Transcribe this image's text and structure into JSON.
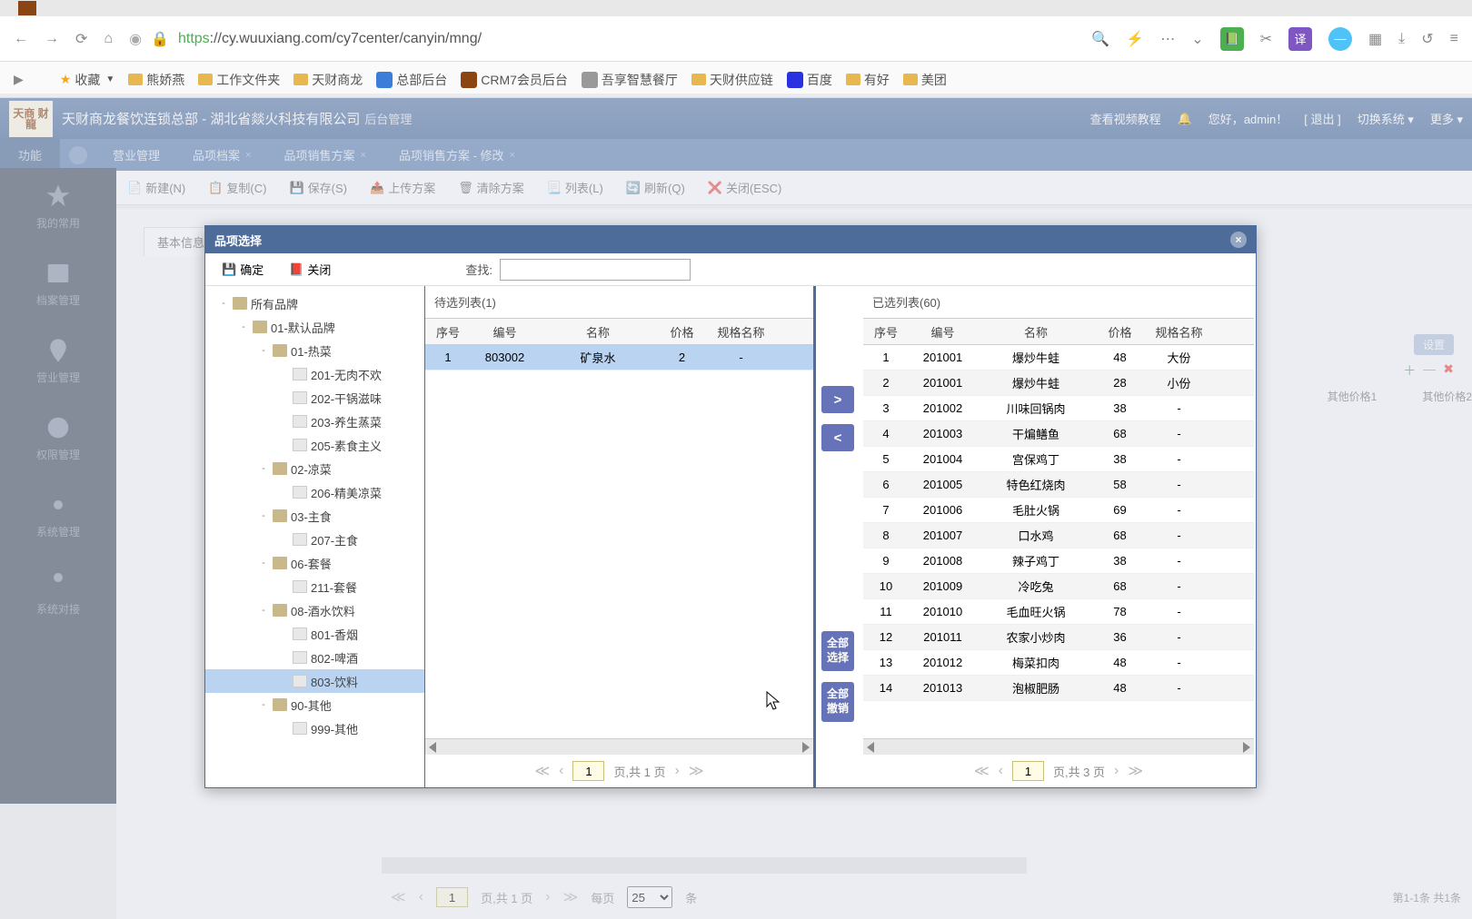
{
  "browser": {
    "url_prefix": "https",
    "url_rest": "://cy.wuuxiang.com/cy7center/canyin/mng/",
    "bookmarks": {
      "fav": "收藏",
      "items": [
        "熊娇燕",
        "工作文件夹",
        "天财商龙",
        "总部后台",
        "CRM7会员后台",
        "吾享智慧餐厅",
        "天财供应链",
        "百度",
        "有好",
        "美团"
      ]
    }
  },
  "app": {
    "logo_text": "天商\n财龍",
    "title": "天财商龙餐饮连锁总部 - 湖北省燚火科技有限公司",
    "subtitle": "后台管理",
    "header_right": {
      "video": "查看视频教程",
      "greet": "您好，",
      "user": "admin！",
      "logout": "[ 退出 ]",
      "switch": "切换系统",
      "more": "更多"
    },
    "func_label": "功能",
    "tabs": [
      "营业管理",
      "品项档案",
      "品项销售方案",
      "品项销售方案 - 修改"
    ],
    "toolbar": [
      "新建(N)",
      "复制(C)",
      "保存(S)",
      "上传方案",
      "清除方案",
      "列表(L)",
      "刷新(Q)",
      "关闭(ESC)"
    ],
    "sub_tab": "基本信息",
    "sidebar": [
      "我的常用",
      "档案管理",
      "营业管理",
      "权限管理",
      "系统管理",
      "系统对接"
    ]
  },
  "modal": {
    "title": "品项选择",
    "ok": "确定",
    "close_btn": "关闭",
    "search_label": "查找:",
    "tree": [
      {
        "lvl": 0,
        "type": "folder",
        "toggle": "-",
        "label": "所有品牌"
      },
      {
        "lvl": 1,
        "type": "folder",
        "toggle": "-",
        "label": "01-默认品牌"
      },
      {
        "lvl": 2,
        "type": "folder",
        "toggle": "-",
        "label": "01-热菜"
      },
      {
        "lvl": 3,
        "type": "leaf",
        "label": "201-无肉不欢"
      },
      {
        "lvl": 3,
        "type": "leaf",
        "label": "202-干锅滋味"
      },
      {
        "lvl": 3,
        "type": "leaf",
        "label": "203-养生蒸菜"
      },
      {
        "lvl": 3,
        "type": "leaf",
        "label": "205-素食主义"
      },
      {
        "lvl": 2,
        "type": "folder",
        "toggle": "-",
        "label": "02-凉菜"
      },
      {
        "lvl": 3,
        "type": "leaf",
        "label": "206-精美凉菜"
      },
      {
        "lvl": 2,
        "type": "folder",
        "toggle": "-",
        "label": "03-主食"
      },
      {
        "lvl": 3,
        "type": "leaf",
        "label": "207-主食"
      },
      {
        "lvl": 2,
        "type": "folder",
        "toggle": "-",
        "label": "06-套餐"
      },
      {
        "lvl": 3,
        "type": "leaf",
        "label": "211-套餐"
      },
      {
        "lvl": 2,
        "type": "folder",
        "toggle": "-",
        "label": "08-酒水饮料"
      },
      {
        "lvl": 3,
        "type": "leaf",
        "label": "801-香烟"
      },
      {
        "lvl": 3,
        "type": "leaf",
        "label": "802-啤酒"
      },
      {
        "lvl": 3,
        "type": "leaf",
        "label": "803-饮料",
        "selected": true
      },
      {
        "lvl": 2,
        "type": "folder",
        "toggle": "-",
        "label": "90-其他"
      },
      {
        "lvl": 3,
        "type": "leaf",
        "label": "999-其他"
      }
    ],
    "columns": {
      "seq": "序号",
      "code": "编号",
      "name": "名称",
      "price": "价格",
      "spec": "规格名称"
    },
    "left": {
      "title": "待选列表(1)",
      "rows": [
        {
          "seq": 1,
          "code": "803002",
          "name": "矿泉水",
          "price": "2",
          "spec": "-"
        }
      ],
      "page": "1",
      "page_text": "页,共 1 页"
    },
    "right": {
      "title": "已选列表(60)",
      "rows": [
        {
          "seq": 1,
          "code": "201001",
          "name": "爆炒牛蛙",
          "price": "48",
          "spec": "大份"
        },
        {
          "seq": 2,
          "code": "201001",
          "name": "爆炒牛蛙",
          "price": "28",
          "spec": "小份"
        },
        {
          "seq": 3,
          "code": "201002",
          "name": "川味回锅肉",
          "price": "38",
          "spec": "-"
        },
        {
          "seq": 4,
          "code": "201003",
          "name": "干煸鳝鱼",
          "price": "68",
          "spec": "-"
        },
        {
          "seq": 5,
          "code": "201004",
          "name": "宫保鸡丁",
          "price": "38",
          "spec": "-"
        },
        {
          "seq": 6,
          "code": "201005",
          "name": "特色红烧肉",
          "price": "58",
          "spec": "-"
        },
        {
          "seq": 7,
          "code": "201006",
          "name": "毛肚火锅",
          "price": "69",
          "spec": "-"
        },
        {
          "seq": 8,
          "code": "201007",
          "name": "口水鸡",
          "price": "68",
          "spec": "-"
        },
        {
          "seq": 9,
          "code": "201008",
          "name": "辣子鸡丁",
          "price": "38",
          "spec": "-"
        },
        {
          "seq": 10,
          "code": "201009",
          "name": "冷吃兔",
          "price": "68",
          "spec": "-"
        },
        {
          "seq": 11,
          "code": "201010",
          "name": "毛血旺火锅",
          "price": "78",
          "spec": "-"
        },
        {
          "seq": 12,
          "code": "201011",
          "name": "农家小炒肉",
          "price": "36",
          "spec": "-"
        },
        {
          "seq": 13,
          "code": "201012",
          "name": "梅菜扣肉",
          "price": "48",
          "spec": "-"
        },
        {
          "seq": 14,
          "code": "201013",
          "name": "泡椒肥肠",
          "price": "48",
          "spec": "-"
        }
      ],
      "page": "1",
      "page_text": "页,共 3 页"
    },
    "move": {
      "right": ">",
      "left": "<",
      "all_sel": "全部选择",
      "all_undo": "全部撤销"
    }
  },
  "bottom": {
    "page": "1",
    "page_text": "页,共 1 页",
    "per_page": "每页",
    "per_val": "25",
    "unit": "条",
    "summary": "第1-1条 共1条",
    "settings": "设置",
    "price_other1": "其他价格1",
    "price_other2": "其他价格2"
  }
}
